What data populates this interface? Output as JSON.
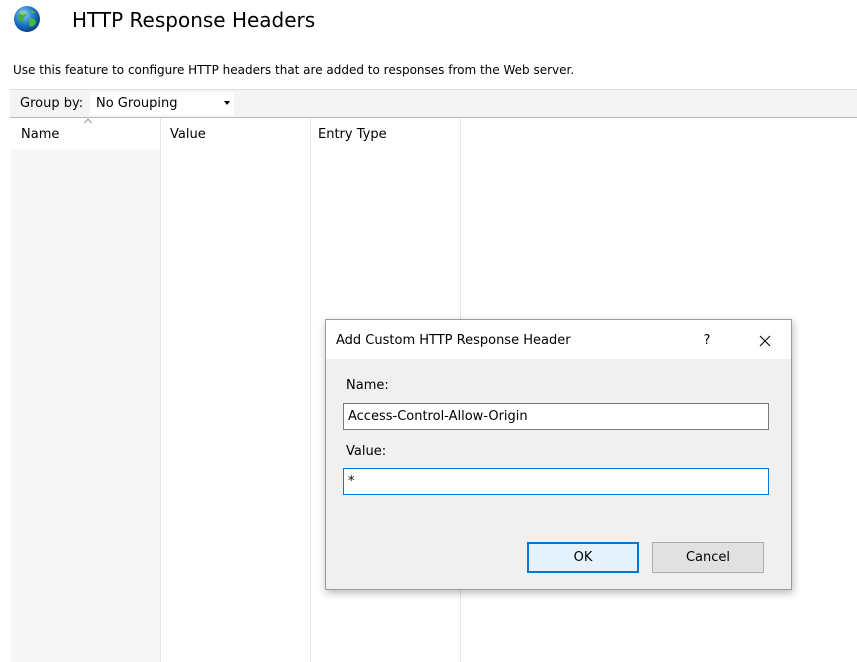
{
  "page": {
    "title": "HTTP Response Headers",
    "description": "Use this feature to configure HTTP headers that are added to responses from the Web server.",
    "icon": "globe-icon"
  },
  "toolbar": {
    "group_by_label": "Group by:",
    "group_by_value": "No Grouping"
  },
  "grid": {
    "columns": [
      "Name",
      "Value",
      "Entry Type"
    ],
    "rows": []
  },
  "dialog": {
    "title": "Add Custom HTTP Response Header",
    "help_label": "?",
    "name_label": "Name:",
    "name_value": "Access-Control-Allow-Origin",
    "value_label": "Value:",
    "value_value": "*",
    "ok_label": "OK",
    "cancel_label": "Cancel"
  },
  "colors": {
    "accent": "#0078d7",
    "dialog_background": "#f0f0f0",
    "toolbar_background": "#f4f4f4"
  }
}
